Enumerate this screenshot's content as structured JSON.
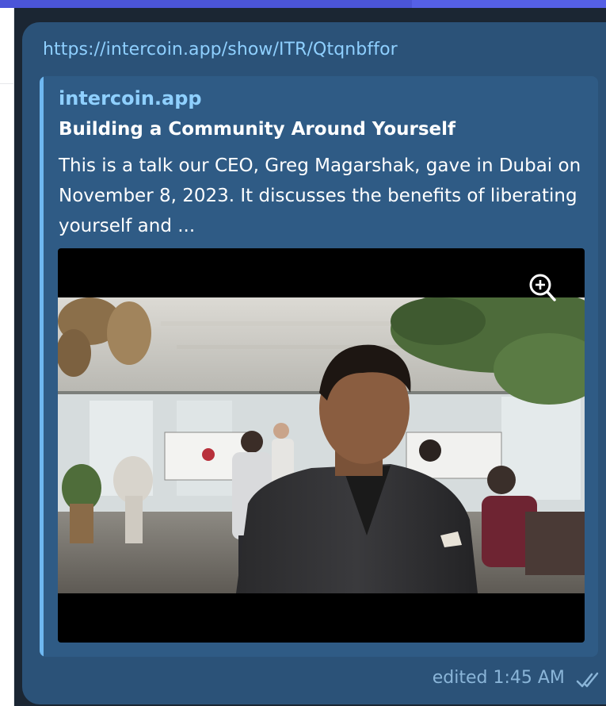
{
  "message": {
    "link_url": "https://intercoin.app/show/ITR/Qtqnbffor",
    "preview": {
      "site_name": "intercoin.app",
      "title": "Building a Community Around Yourself",
      "description": "This is a talk our CEO, Greg Magarshak, gave in Dubai on November 8, 2023. It discusses the benefits of liberating yourself and ..."
    },
    "media_icon": "zoom-in-icon",
    "status_text": "edited 1:45 AM",
    "status_icon": "double-check-icon"
  },
  "colors": {
    "bubble": "#2b5278",
    "link": "#8fd0ff",
    "accent_bar": "#6fb8f1",
    "meta_text": "#8ab5d8"
  }
}
